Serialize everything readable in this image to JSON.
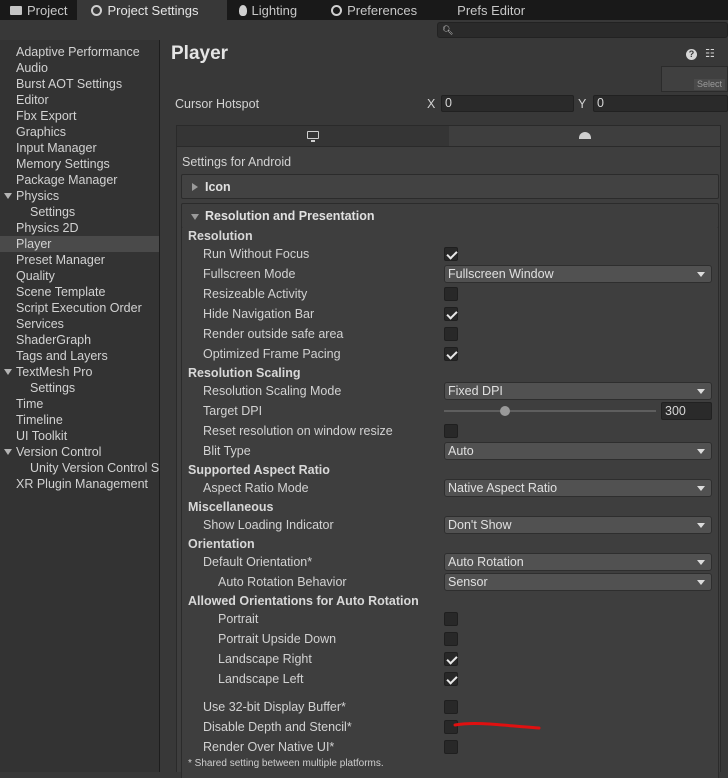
{
  "tabs": [
    {
      "label": "Project",
      "icon": "folder-icon"
    },
    {
      "label": "Project Settings",
      "icon": "gear-icon"
    },
    {
      "label": "Lighting",
      "icon": "bulb-icon"
    },
    {
      "label": "Preferences",
      "icon": "gear-icon"
    },
    {
      "label": "Prefs Editor",
      "icon": ""
    }
  ],
  "search": {
    "value": "",
    "icon": "search-icon"
  },
  "sidebar": {
    "items": [
      {
        "label": "Adaptive Performance"
      },
      {
        "label": "Audio"
      },
      {
        "label": "Burst AOT Settings"
      },
      {
        "label": "Editor"
      },
      {
        "label": "Fbx Export"
      },
      {
        "label": "Graphics"
      },
      {
        "label": "Input Manager"
      },
      {
        "label": "Memory Settings"
      },
      {
        "label": "Package Manager"
      },
      {
        "label": "Physics"
      },
      {
        "label": "Settings"
      },
      {
        "label": "Physics 2D"
      },
      {
        "label": "Player"
      },
      {
        "label": "Preset Manager"
      },
      {
        "label": "Quality"
      },
      {
        "label": "Scene Template"
      },
      {
        "label": "Script Execution Order"
      },
      {
        "label": "Services"
      },
      {
        "label": "ShaderGraph"
      },
      {
        "label": "Tags and Layers"
      },
      {
        "label": "TextMesh Pro"
      },
      {
        "label": "Settings"
      },
      {
        "label": "Time"
      },
      {
        "label": "Timeline"
      },
      {
        "label": "UI Toolkit"
      },
      {
        "label": "Version Control"
      },
      {
        "label": "Unity Version Control Settings"
      },
      {
        "label": "XR Plugin Management"
      }
    ],
    "selected": "Player"
  },
  "header": {
    "title": "Player",
    "select_label": "Select"
  },
  "cursor_hotspot": {
    "label": "Cursor Hotspot",
    "x_label": "X",
    "x_value": "0",
    "y_label": "Y",
    "y_value": "0"
  },
  "platform": {
    "settings_for": "Settings for Android",
    "tabs": [
      "Standalone",
      "Android"
    ],
    "active": "Android"
  },
  "icon_section": {
    "title": "Icon"
  },
  "res_section": {
    "title": "Resolution and Presentation",
    "resolution_h": "Resolution",
    "run_without_focus": {
      "label": "Run Without Focus",
      "checked": true
    },
    "fullscreen_mode": {
      "label": "Fullscreen Mode",
      "value": "Fullscreen Window"
    },
    "resizeable_activity": {
      "label": "Resizeable Activity",
      "checked": false
    },
    "hide_nav_bar": {
      "label": "Hide Navigation Bar",
      "checked": true
    },
    "render_outside_safe": {
      "label": "Render outside safe area",
      "checked": false
    },
    "optimized_frame_pacing": {
      "label": "Optimized Frame Pacing",
      "checked": true
    },
    "scaling_h": "Resolution Scaling",
    "scaling_mode": {
      "label": "Resolution Scaling Mode",
      "value": "Fixed DPI"
    },
    "target_dpi": {
      "label": "Target DPI",
      "value": "300",
      "fraction": 0.29
    },
    "reset_on_resize": {
      "label": "Reset resolution on window resize",
      "checked": false
    },
    "blit_type": {
      "label": "Blit Type",
      "value": "Auto"
    },
    "aspect_h": "Supported Aspect Ratio",
    "aspect_mode": {
      "label": "Aspect Ratio Mode",
      "value": "Native Aspect Ratio"
    },
    "misc_h": "Miscellaneous",
    "loading_indicator": {
      "label": "Show Loading Indicator",
      "value": "Don't Show"
    },
    "orientation_h": "Orientation",
    "default_orientation": {
      "label": "Default Orientation*",
      "value": "Auto Rotation"
    },
    "auto_rotation_behavior": {
      "label": "Auto Rotation Behavior",
      "value": "Sensor"
    },
    "allowed_h": "Allowed Orientations for Auto Rotation",
    "portrait": {
      "label": "Portrait",
      "checked": false
    },
    "portrait_upside_down": {
      "label": "Portrait Upside Down",
      "checked": false
    },
    "landscape_right": {
      "label": "Landscape Right",
      "checked": true
    },
    "landscape_left": {
      "label": "Landscape Left",
      "checked": true
    },
    "display_buffer_32": {
      "label": "Use 32-bit Display Buffer*",
      "checked": false
    },
    "disable_depth_stencil": {
      "label": "Disable Depth and Stencil*",
      "checked": false
    },
    "render_over_native": {
      "label": "Render Over Native UI*",
      "checked": false
    },
    "footnote": "* Shared setting between multiple platforms."
  },
  "colors": {
    "background": "#383838",
    "panel": "#3e3e3e",
    "annotation": "#e01010"
  }
}
